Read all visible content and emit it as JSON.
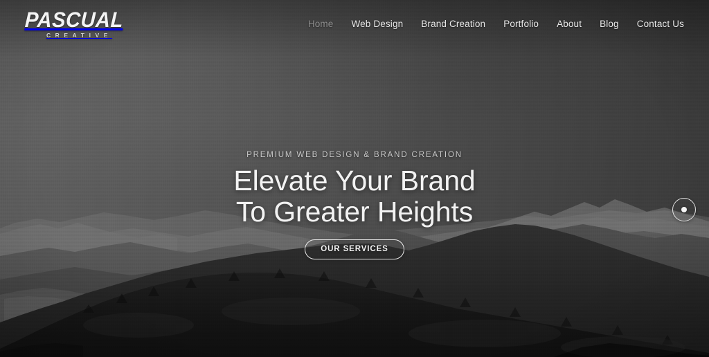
{
  "site": {
    "logo": {
      "primary": "PASCUAL",
      "secondary": "CREATIVE"
    }
  },
  "header": {
    "nav_items": [
      {
        "label": "Home",
        "active": true
      },
      {
        "label": "Web Design",
        "active": false
      },
      {
        "label": "Brand Creation",
        "active": false
      },
      {
        "label": "Portfolio",
        "active": false
      },
      {
        "label": "About",
        "active": false
      },
      {
        "label": "Blog",
        "active": false
      },
      {
        "label": "Contact Us",
        "active": false
      }
    ]
  },
  "hero": {
    "eyebrow": "PREMIUM WEB DESIGN & BRAND CREATION",
    "headline_line_1": "Elevate Your Brand",
    "headline_line_2": "To Greater Heights",
    "cta_label": "OUR SERVICES",
    "scroll_indicator": "scroll-indicator-dot",
    "background_description": "grayscale mountain landscape at dusk"
  },
  "colors": {
    "sky_light": "#5e5e5e",
    "sky_dark": "#393939",
    "ridge_far": "#6a6a6a",
    "ridge_mid": "#4f4f4f",
    "ridge_near": "#2c2c2c",
    "foreground": "#151515",
    "text_primary": "#f2f2f2",
    "text_muted": "#c9c9c9",
    "nav_active": "#8d8d8d",
    "accent_border": "#eaeaea"
  }
}
